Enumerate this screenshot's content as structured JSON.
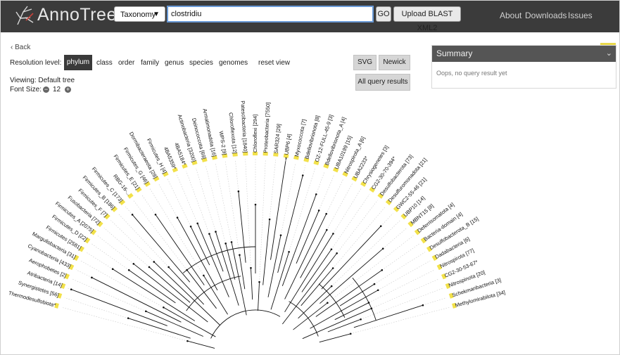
{
  "header": {
    "brand": "AnnoTree",
    "db_select": "Taxonomy",
    "search_value": "clostridiu",
    "go_label": "GO",
    "blast_label": "Upload BLAST XML2",
    "nav": [
      "About",
      "Downloads",
      "Issues"
    ]
  },
  "controls": {
    "back_label": "Back",
    "resolution_label": "Resolution level:",
    "levels": [
      "phylum",
      "class",
      "order",
      "family",
      "genus",
      "species",
      "genomes"
    ],
    "active_level": "phylum",
    "reset_label": "reset view",
    "viewing": "Viewing: Default tree",
    "font_size_label": "Font Size:",
    "font_size": "12",
    "svg_label": "SVG",
    "newick_label": "Newick",
    "all_results_label": "All query results"
  },
  "summary": {
    "title": "Summary",
    "message": "Oops, no query result yet"
  },
  "colors": {
    "topbar": "#3b3b3b",
    "highlight": "#f2e14a",
    "summary_head": "#555555"
  },
  "tree": {
    "leaves": [
      "Thermodesulfobiota*",
      "Synergistetes [56]",
      "Atribacteria [14]",
      "Aerophobetes [2]",
      "Cyanobacteria [433]",
      "Margulisbacteria [31]",
      "Firmicutes [2581]",
      "Firmicutes_D [22]",
      "Firmicutes_A [2075]",
      "Fusobacteria [72]",
      "Firmicutes_F [7]",
      "Firmicutes_B [186]",
      "Firmicutes_C [173]",
      "RBG-16-...",
      "Firmicutes_E [21]",
      "Firmicutes_G [46]",
      "Dormibacteraeota [28]",
      "Firmicutes_H [4]",
      "4BA5359*",
      "4BA5184*",
      "Actinobacteria [3200]",
      "Deinococcota [69]",
      "Armatimonadota [16]",
      "WPS-2 [9]",
      "Chloroflexota [12]",
      "Patescibacteria [1840]",
      "Chloroflexi [294]",
      "Proteobacteria [7550]",
      "SAR324 [29]",
      "UBP6 [4]",
      "Myxococcota [7]",
      "Bdellovibrionota [8]",
      "OZ-12-FULL-45-9 [3]",
      "Bdellovibrionota_A [4]",
      "UBA10199 [15]",
      "Nitrospirota_A [6]",
      "UBA2233*",
      "Chrysiogenetes [3]",
      "CG2-30-70-394*",
      "Desulfobacterota [73]",
      "Desulfuromonadota [21]",
      "GWC2-55-46 [21]",
      "UBP10 [14]",
      "MBNT15 [8]",
      "Deferrisomatota [4]",
      "Bacteria-domain [4]",
      "Desulfobacterota_B [15]",
      "Dadabacteria [6]",
      "Nitrospirota [77]",
      "CG2-30-53-67*",
      "Nitrospinota [20]",
      "Schekmanbacteria [3]",
      "Methylomirabilota [34]"
    ]
  }
}
